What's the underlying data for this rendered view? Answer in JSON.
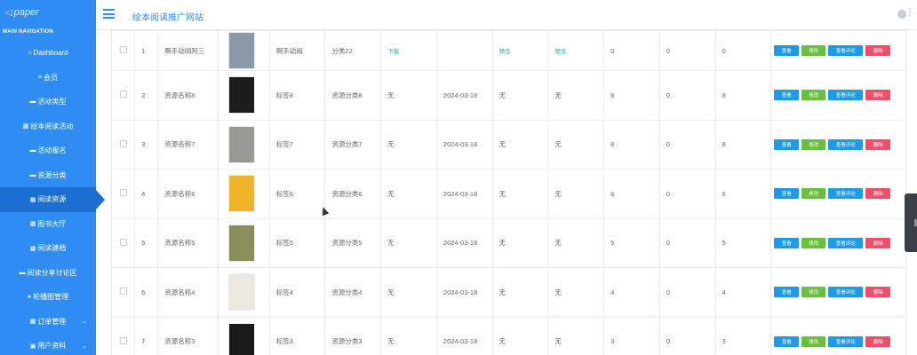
{
  "brand": {
    "logo_text": "paper",
    "accent": "#2f8cf3",
    "active_bg": "#1c6ed0"
  },
  "sidebar": {
    "heading": "MAIN NAVIGATION",
    "items": [
      {
        "label": "Dashboard",
        "icon": "home-icon"
      },
      {
        "label": "会员",
        "icon": "list-icon"
      },
      {
        "label": "活动类型",
        "icon": "comment-icon"
      },
      {
        "label": "绘本阅读活动",
        "icon": "grid-icon"
      },
      {
        "label": "活动报名",
        "icon": "comment-icon"
      },
      {
        "label": "资源分类",
        "icon": "comment-icon"
      },
      {
        "label": "阅读资源",
        "icon": "grid-icon"
      },
      {
        "label": "图书大厅",
        "icon": "grid-icon"
      },
      {
        "label": "阅读建档",
        "icon": "grid-icon"
      },
      {
        "label": "阅读分享讨论区",
        "icon": "comment-icon"
      },
      {
        "label": "轮播图管理",
        "icon": "user-icon"
      },
      {
        "label": "订单管理",
        "icon": "grid-icon",
        "expandable": true
      },
      {
        "label": "用户资料",
        "icon": "profile-icon",
        "expandable": true
      }
    ],
    "active_index": 6
  },
  "header": {
    "title": "绘本阅读推广网站"
  },
  "buttons": {
    "view": "查看",
    "edit": "修改",
    "comments": "查看评论",
    "delete": "删除"
  },
  "rows": [
    {
      "no": "1",
      "name": "啊手动阀阿三",
      "tag": "啊手动阀",
      "category": "分类22",
      "file": "下载",
      "date": "",
      "c1": "预览",
      "c2": "预览",
      "n1": "0",
      "n2": "0",
      "n3": "0",
      "cover_color": "#8a9aa8"
    },
    {
      "no": "2",
      "name": "资源名称8",
      "tag": "标签8",
      "category": "资源分类8",
      "file": "无",
      "date": "2024-03-18",
      "c1": "无",
      "c2": "无",
      "n1": "8",
      "n2": "0",
      "n3": "8",
      "cover_color": "#1c1c1c"
    },
    {
      "no": "3",
      "name": "资源名称7",
      "tag": "标签7",
      "category": "资源分类7",
      "file": "无",
      "date": "2024-03-18",
      "c1": "无",
      "c2": "无",
      "n1": "8",
      "n2": "0",
      "n3": "8",
      "cover_color": "#9a9a94"
    },
    {
      "no": "4",
      "name": "资源名称6",
      "tag": "标签6",
      "category": "资源分类6",
      "file": "无",
      "date": "2024-03-18",
      "c1": "无",
      "c2": "无",
      "n1": "6",
      "n2": "0",
      "n3": "6",
      "cover_color": "#f0b429"
    },
    {
      "no": "5",
      "name": "资源名称5",
      "tag": "标签5",
      "category": "资源分类5",
      "file": "无",
      "date": "2024-03-18",
      "c1": "无",
      "c2": "无",
      "n1": "5",
      "n2": "0",
      "n3": "5",
      "cover_color": "#8b8f5c"
    },
    {
      "no": "6",
      "name": "资源名称4",
      "tag": "标签4",
      "category": "资源分类4",
      "file": "无",
      "date": "2024-03-18",
      "c1": "无",
      "c2": "无",
      "n1": "4",
      "n2": "0",
      "n3": "4",
      "cover_color": "#ece8df"
    },
    {
      "no": "7",
      "name": "资源名称3",
      "tag": "标签3",
      "category": "资源分类3",
      "file": "无",
      "date": "2024-03-18",
      "c1": "无",
      "c2": "无",
      "n1": "3",
      "n2": "0",
      "n3": "3",
      "cover_color": "#1a1a1a"
    }
  ]
}
